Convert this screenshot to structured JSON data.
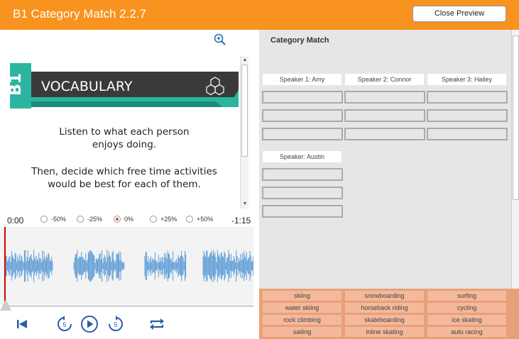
{
  "header": {
    "title": "B1 Category Match 2.2.7",
    "close_label": "Close Preview"
  },
  "slide": {
    "level_badge": "B1",
    "banner_title": "VOCABULARY",
    "instruction_1_line1": "Listen to what each person",
    "instruction_1_line2": "enjoys doing.",
    "instruction_2_line1": "Then, decide which free time activities",
    "instruction_2_line2": "would be best for each of them."
  },
  "audio": {
    "current_time": "0:00",
    "remaining_time": "-1:15",
    "rates": [
      {
        "label": "-50%",
        "selected": false
      },
      {
        "label": "-25%",
        "selected": false
      },
      {
        "label": "0%",
        "selected": true
      },
      {
        "label": "+25%",
        "selected": false
      },
      {
        "label": "+50%",
        "selected": false
      }
    ],
    "playhead_fraction": 0.0
  },
  "activity": {
    "title": "Category Match",
    "speakers": [
      "Speaker 1: Amy",
      "Speaker 2: Connor",
      "Speaker 3: Hailey",
      "Speaker: Austin"
    ]
  },
  "word_bank": [
    [
      "skiing",
      "snowboarding",
      "surfing"
    ],
    [
      "water skiing",
      "horseback riding",
      "cycling"
    ],
    [
      "rock climbing",
      "skateboarding",
      "ice skating"
    ],
    [
      "sailing",
      "inline skating",
      "auto racing"
    ]
  ],
  "colors": {
    "accent": "#f7931e",
    "teal": "#2bb5a0",
    "bank": "#e8a07a",
    "tile": "#f4b89a",
    "wave": "#5b9bd5"
  },
  "icons": [
    "zoom-in-icon",
    "skip-to-start-icon",
    "rewind-5-icon",
    "play-icon",
    "forward-5-icon",
    "loop-icon"
  ]
}
